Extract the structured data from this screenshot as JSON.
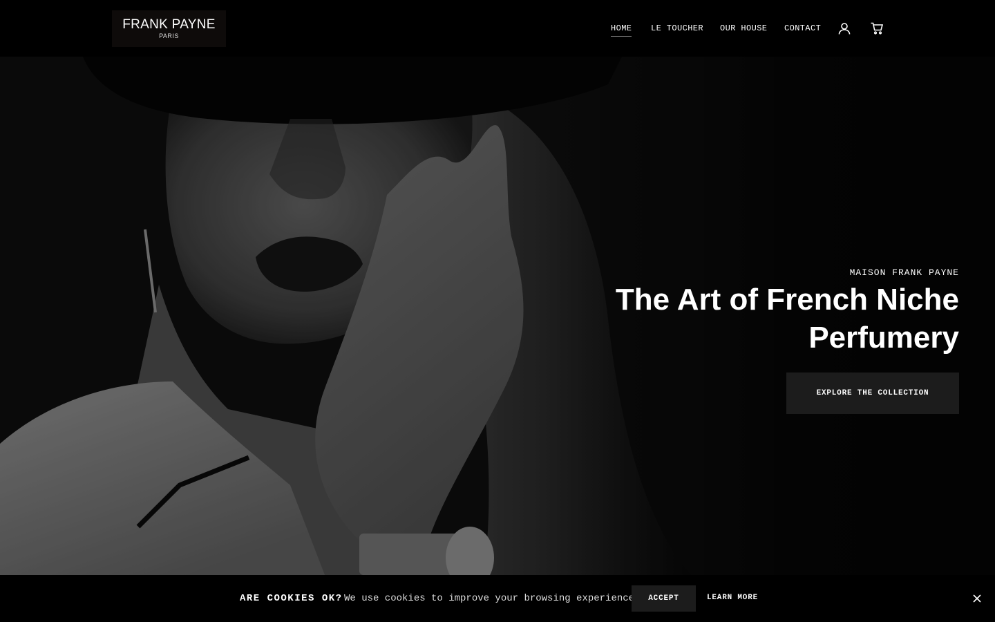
{
  "brand": {
    "name": "FRANK PAYNE",
    "sub": "PARIS"
  },
  "nav": {
    "items": [
      {
        "label": "HOME"
      },
      {
        "label": "LE TOUCHER"
      },
      {
        "label": "OUR HOUSE"
      },
      {
        "label": "CONTACT"
      }
    ],
    "active": "HOME",
    "icons": [
      "account-icon",
      "cart-icon"
    ]
  },
  "hero": {
    "eyebrow": "MAISON FRANK PAYNE",
    "title": "The Art of French Niche Perfumery",
    "cta": "EXPLORE THE COLLECTION"
  },
  "cookie": {
    "title": "ARE COOKIES OK?",
    "text": "We use cookies to improve your browsing experience",
    "accept": "ACCEPT",
    "learn_more": "LEARN MORE",
    "close_icon": "close-icon"
  },
  "colors": {
    "background": "#000000",
    "button": "#1c1c1c",
    "text": "#ffffff"
  }
}
